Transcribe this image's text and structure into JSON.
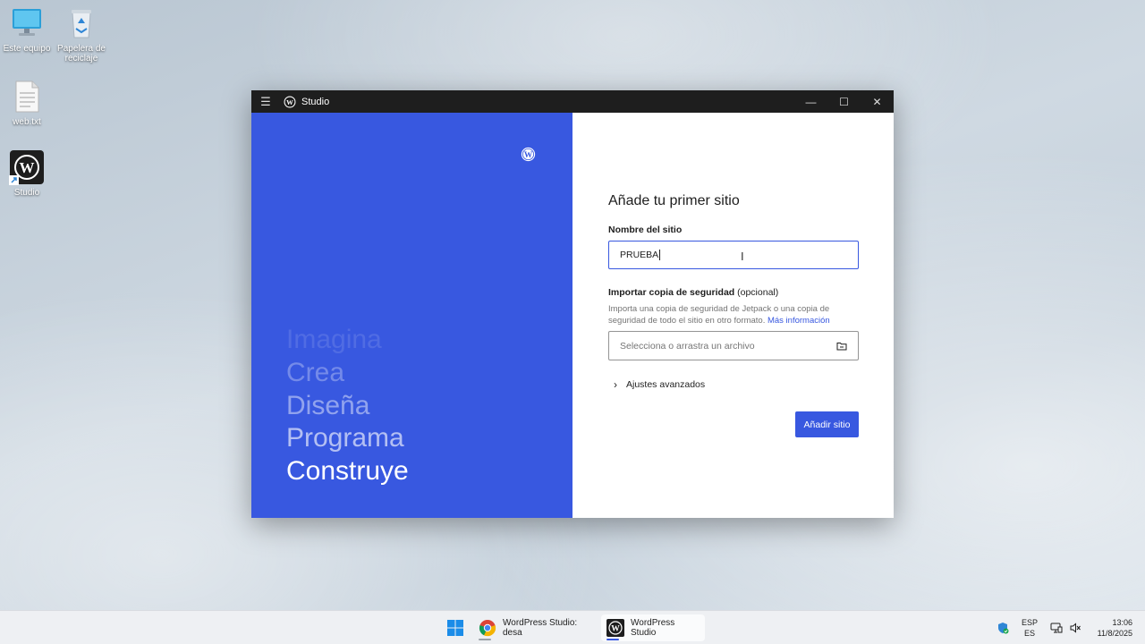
{
  "desktop": {
    "icons": [
      {
        "label": "Este equipo"
      },
      {
        "label": "Papelera de reciclaje"
      },
      {
        "label": "web.txt"
      },
      {
        "label": "Studio"
      }
    ]
  },
  "window": {
    "title": "Studio",
    "menu_icon": "☰",
    "minimize": "—",
    "maximize": "☐",
    "close": "✕"
  },
  "left_panel": {
    "words": [
      "Imagina",
      "Crea",
      "Diseña",
      "Programa",
      "Construye"
    ]
  },
  "form": {
    "title": "Añade tu primer sitio",
    "name_label": "Nombre del sitio",
    "name_value": "PRUEBA",
    "import_label": "Importar copia de seguridad",
    "import_optional": "(opcional)",
    "import_help": "Importa una copia de seguridad de Jetpack o una copia de seguridad de todo el sitio en otro formato.",
    "import_help_link": "Más información",
    "file_placeholder": "Selecciona o arrastra un archivo",
    "advanced_label": "Ajustes avanzados",
    "submit_label": "Añadir sitio"
  },
  "taskbar": {
    "apps": [
      {
        "label": "WordPress Studio: desa"
      },
      {
        "label": "WordPress Studio"
      }
    ],
    "language_top": "ESP",
    "language_bottom": "ES",
    "time": "13:06",
    "date": "11/8/2025"
  },
  "colors": {
    "accent": "#3858e0",
    "titlebar": "#1e1e1e"
  }
}
